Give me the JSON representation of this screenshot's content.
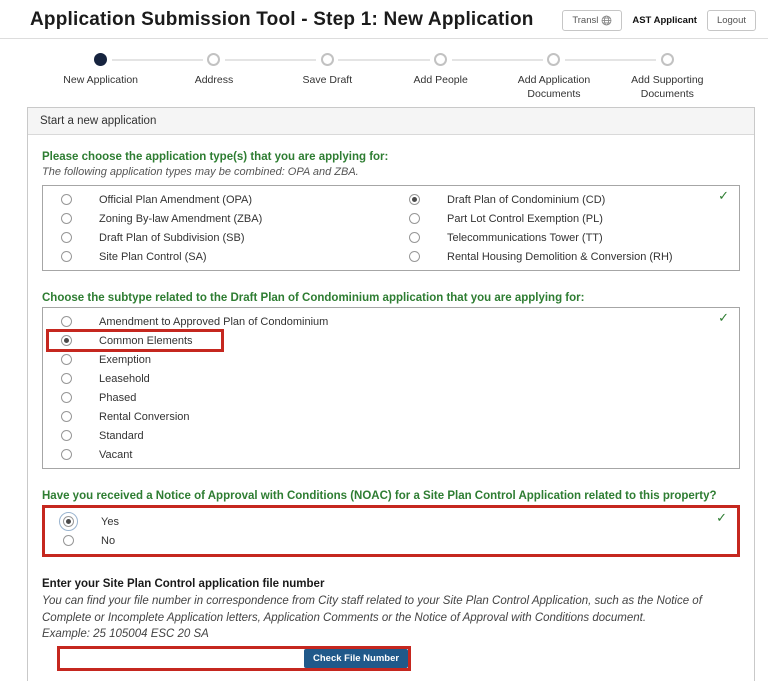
{
  "header": {
    "title": "Application Submission Tool - Step 1: New Application",
    "translate_label": "Transl",
    "user_label": "AST Applicant",
    "logout_label": "Logout"
  },
  "stepper": {
    "steps": [
      {
        "label": "New Application",
        "active": true
      },
      {
        "label": "Address",
        "active": false
      },
      {
        "label": "Save Draft",
        "active": false
      },
      {
        "label": "Add People",
        "active": false
      },
      {
        "label": "Add Application Documents",
        "active": false
      },
      {
        "label": "Add Supporting Documents",
        "active": false
      }
    ]
  },
  "panel": {
    "header": "Start a new application",
    "type_question": {
      "heading": "Please choose the application type(s) that you are applying for:",
      "note": "The following application types may be combined: OPA and ZBA.",
      "columns": [
        [
          {
            "label": "Official Plan Amendment (OPA)",
            "selected": false
          },
          {
            "label": "Zoning By-law Amendment (ZBA)",
            "selected": false
          },
          {
            "label": "Draft Plan of Subdivision (SB)",
            "selected": false
          },
          {
            "label": "Site Plan Control (SA)",
            "selected": false
          }
        ],
        [
          {
            "label": "Draft Plan of Condominium (CD)",
            "selected": true
          },
          {
            "label": "Part Lot Control Exemption (PL)",
            "selected": false
          },
          {
            "label": "Telecommunications Tower (TT)",
            "selected": false
          },
          {
            "label": "Rental Housing Demolition & Conversion (RH)",
            "selected": false
          }
        ]
      ]
    },
    "subtype_question": {
      "heading": "Choose the subtype related to the Draft Plan of Condominium application that you are applying for:",
      "options": [
        {
          "label": "Amendment to Approved Plan of Condominium",
          "selected": false
        },
        {
          "label": "Common Elements",
          "selected": true,
          "highlighted": true
        },
        {
          "label": "Exemption",
          "selected": false
        },
        {
          "label": "Leasehold",
          "selected": false
        },
        {
          "label": "Phased",
          "selected": false
        },
        {
          "label": "Rental Conversion",
          "selected": false
        },
        {
          "label": "Standard",
          "selected": false
        },
        {
          "label": "Vacant",
          "selected": false
        }
      ]
    },
    "noac_question": {
      "heading": "Have you received a Notice of Approval with Conditions (NOAC) for a Site Plan Control Application related to this property?",
      "options": [
        {
          "label": "Yes",
          "selected": true,
          "focus": true
        },
        {
          "label": "No",
          "selected": false
        }
      ]
    },
    "file_number": {
      "heading": "Enter your Site Plan Control application file number",
      "help_text": "You can find your file number in correspondence from City staff related to your Site Plan Control Application, such as the Notice of Complete or Incomplete Application letters, Application Comments or the Notice of Approval with Conditions document.",
      "example": "Example: 25 105004 ESC 20 SA",
      "input_value": "",
      "button_label": "Check File Number"
    }
  },
  "icons": {
    "check_mark": "✓"
  },
  "colors": {
    "heading_green": "#2e7d32",
    "check_green": "#2e7d32",
    "highlight_red": "#c5271f",
    "button_blue": "#20598a",
    "step_active": "#16243f"
  }
}
